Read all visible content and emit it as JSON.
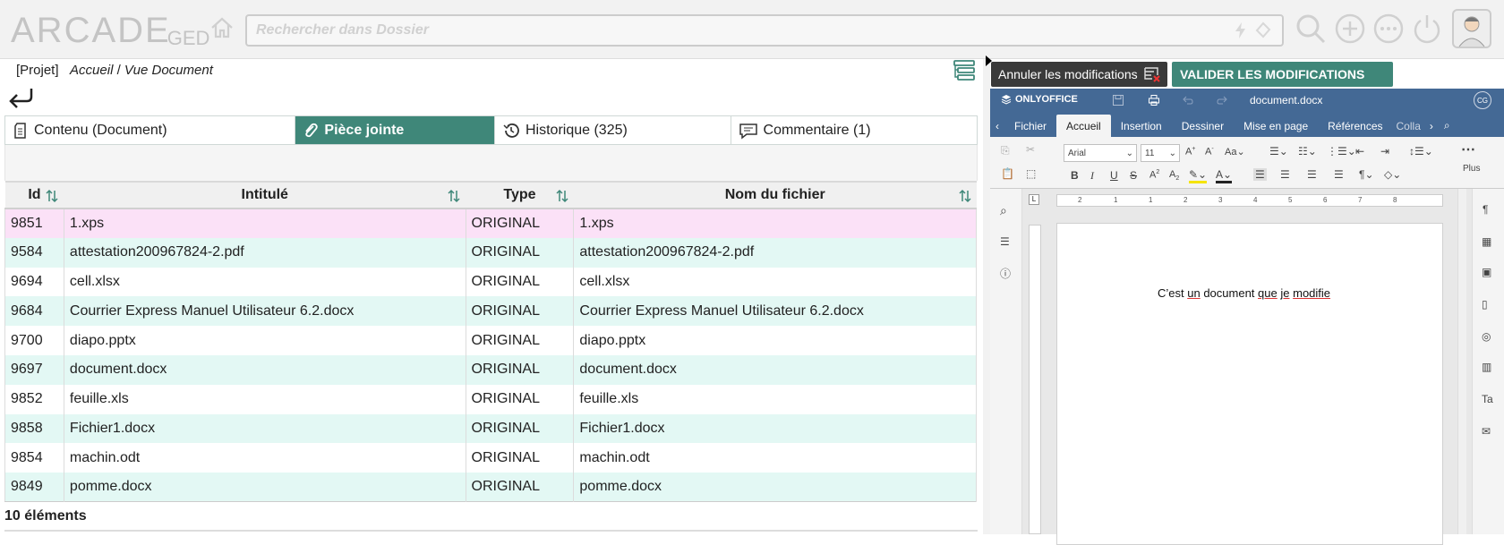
{
  "topbar": {
    "logo_main": "ARCADE",
    "logo_sub": "GED",
    "search_placeholder": "Rechercher dans Dossier"
  },
  "breadcrumb": {
    "project": "[Projet]",
    "home": "Accueil",
    "separator": "/",
    "current": "Vue Document"
  },
  "tabs": [
    {
      "label": "Contenu (Document)"
    },
    {
      "label": "Pièce jointe"
    },
    {
      "label": "Historique (325)"
    },
    {
      "label": "Commentaire (1)"
    }
  ],
  "table": {
    "columns": [
      "Id",
      "Intitulé",
      "Type",
      "Nom du fichier"
    ],
    "rows": [
      {
        "id": "9851",
        "title": "1.xps",
        "type": "ORIGINAL",
        "file": "1.xps"
      },
      {
        "id": "9584",
        "title": "attestation200967824-2.pdf",
        "type": "ORIGINAL",
        "file": "attestation200967824-2.pdf"
      },
      {
        "id": "9694",
        "title": "cell.xlsx",
        "type": "ORIGINAL",
        "file": "cell.xlsx"
      },
      {
        "id": "9684",
        "title": "Courrier Express Manuel Utilisateur 6.2.docx",
        "type": "ORIGINAL",
        "file": "Courrier Express Manuel Utilisateur 6.2.docx"
      },
      {
        "id": "9700",
        "title": "diapo.pptx",
        "type": "ORIGINAL",
        "file": "diapo.pptx"
      },
      {
        "id": "9697",
        "title": "document.docx",
        "type": "ORIGINAL",
        "file": "document.docx"
      },
      {
        "id": "9852",
        "title": "feuille.xls",
        "type": "ORIGINAL",
        "file": "feuille.xls"
      },
      {
        "id": "9858",
        "title": "Fichier1.docx",
        "type": "ORIGINAL",
        "file": "Fichier1.docx"
      },
      {
        "id": "9854",
        "title": "machin.odt",
        "type": "ORIGINAL",
        "file": "machin.odt"
      },
      {
        "id": "9849",
        "title": "pomme.docx",
        "type": "ORIGINAL",
        "file": "pomme.docx"
      }
    ],
    "count": "10 éléments"
  },
  "actions": {
    "cancel_label": "Annuler les modifications",
    "validate_label": "VALIDER LES MODIFICATIONS"
  },
  "onlyoffice": {
    "brand": "ONLYOFFICE",
    "document_name": "document.docx",
    "user_initials": "CG",
    "tabs": [
      "Fichier",
      "Accueil",
      "Insertion",
      "Dessiner",
      "Mise en page",
      "Références",
      "Colla"
    ],
    "font_name": "Arial",
    "font_size": "11",
    "more_label": "Plus",
    "ruler_marks": [
      "2",
      "1",
      "1",
      "2",
      "3",
      "4",
      "5",
      "6",
      "7",
      "8"
    ],
    "doc_text_parts": [
      "C’est ",
      "un",
      " document ",
      "que",
      " ",
      "je",
      " ",
      "modifie"
    ]
  },
  "colors": {
    "accent": "#3f8779",
    "oo_header": "#446995",
    "row_pink": "#fbe1f7",
    "row_mint": "#e3f8f4"
  }
}
